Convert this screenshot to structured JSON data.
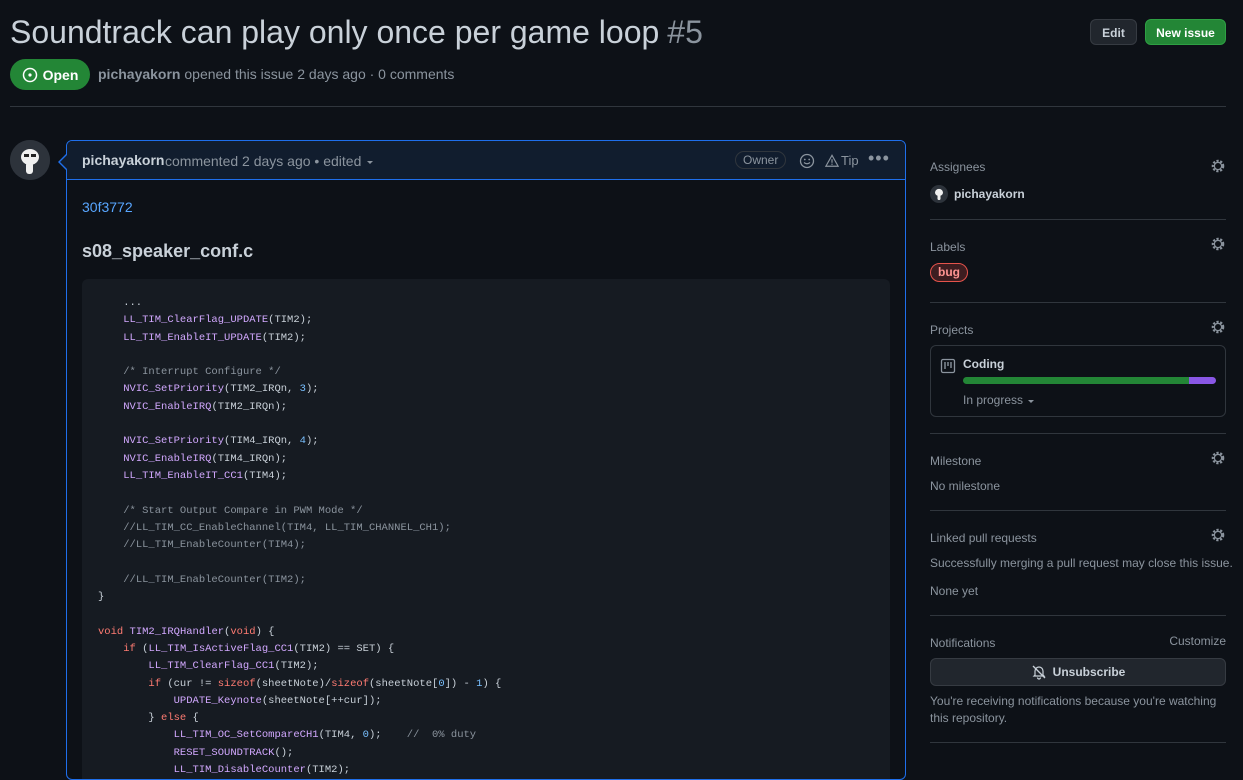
{
  "issue": {
    "title": "Soundtrack can play only once per game loop",
    "number": "#5",
    "state": "Open",
    "author": "pichayakorn",
    "meta_text": "opened this issue 2 days ago · 0 comments"
  },
  "header_buttons": {
    "edit": "Edit",
    "new_issue": "New issue"
  },
  "comment": {
    "author": "pichayakorn",
    "meta": "commented 2 days ago • edited",
    "owner_badge": "Owner",
    "tip": "Tip",
    "commit_link": "30f3772",
    "file_heading": "s08_speaker_conf.c"
  },
  "sidebar": {
    "assignees": {
      "heading": "Assignees",
      "user": "pichayakorn"
    },
    "labels": {
      "heading": "Labels",
      "items": [
        "bug"
      ]
    },
    "projects": {
      "heading": "Projects",
      "name": "Coding",
      "status": "In progress",
      "progress_done": 0.895,
      "colors": {
        "done": "#238636",
        "in_progress": "#8957e5"
      }
    },
    "milestone": {
      "heading": "Milestone",
      "value": "No milestone"
    },
    "linked_prs": {
      "heading": "Linked pull requests",
      "description": "Successfully merging a pull request may close this issue.",
      "value": "None yet"
    },
    "notifications": {
      "heading": "Notifications",
      "customize": "Customize",
      "button": "Unsubscribe",
      "reason": "You're receiving notifications because you're watching this repository."
    }
  },
  "colors": {
    "accent": "#1f6feb",
    "open": "#238636",
    "link": "#58a6ff"
  },
  "icons": [
    "issue-opened-icon",
    "smiley-icon",
    "alert-icon",
    "kebab-icon",
    "gear-icon",
    "project-icon",
    "bell-slash-icon",
    "triangle-down-icon"
  ]
}
